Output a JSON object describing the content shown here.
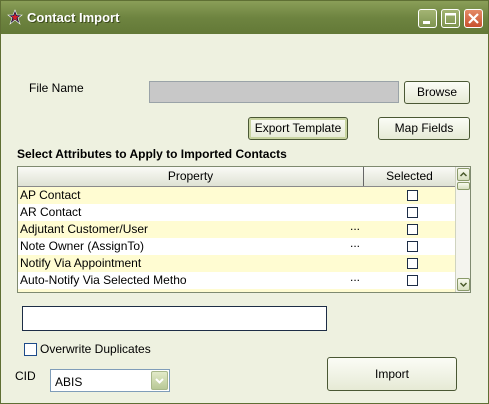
{
  "window": {
    "title": "Contact Import",
    "colors": {
      "titlebar": "#6e8440",
      "body": "#eef1e0",
      "row_alt": "#fffcd2",
      "close_button": "#c8512e"
    }
  },
  "file": {
    "label": "File Name",
    "value": "",
    "browse_label": "Browse"
  },
  "toolbar": {
    "export_template_label": "Export Template",
    "map_fields_label": "Map Fields"
  },
  "attributes": {
    "title": "Select Attributes to Apply to Imported Contacts",
    "columns": [
      "Property",
      "Selected"
    ],
    "rows": [
      {
        "property": "AP Contact",
        "has_more": false,
        "selected": false
      },
      {
        "property": "AR Contact",
        "has_more": false,
        "selected": false
      },
      {
        "property": "Adjutant Customer/User",
        "has_more": true,
        "more_label": "...",
        "selected": false
      },
      {
        "property": "Note Owner (AssignTo)",
        "has_more": true,
        "more_label": "...",
        "selected": false
      },
      {
        "property": "Notify Via Appointment",
        "has_more": false,
        "selected": false
      },
      {
        "property": "Auto-Notify Via Selected Metho",
        "has_more": true,
        "more_label": "...",
        "selected": false
      }
    ]
  },
  "status_input": {
    "value": ""
  },
  "overwrite": {
    "label": "Overwrite Duplicates",
    "checked": false
  },
  "cid": {
    "label": "CID",
    "value": "ABIS"
  },
  "import_label": "Import"
}
